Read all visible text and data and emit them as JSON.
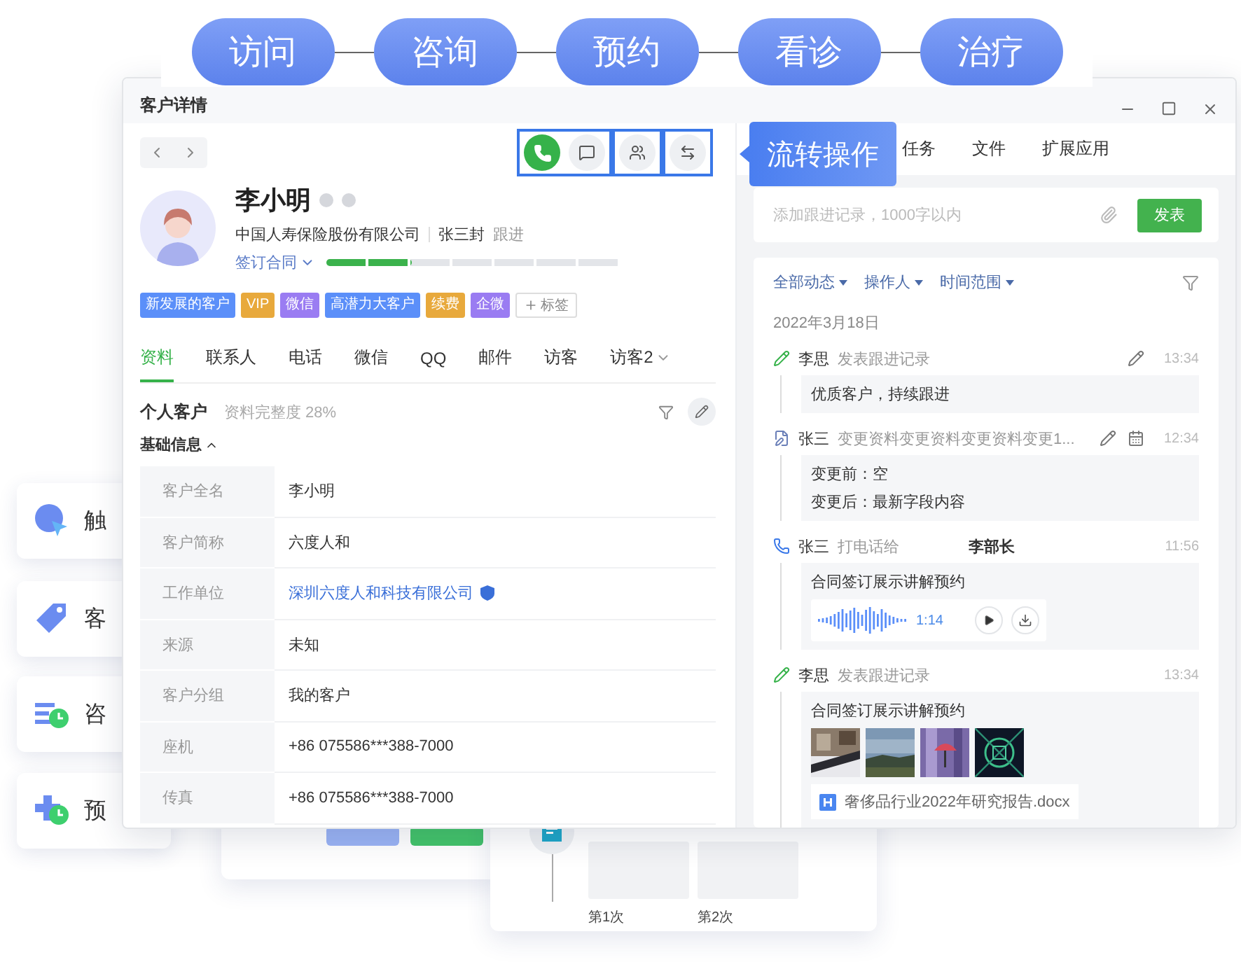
{
  "flow_steps": [
    {
      "label": "访问"
    },
    {
      "label": "咨询"
    },
    {
      "label": "预约"
    },
    {
      "label": "看诊"
    },
    {
      "label": "治疗"
    }
  ],
  "side_cards": [
    {
      "kind": "reach",
      "label": "触"
    },
    {
      "kind": "tag",
      "label": "客"
    },
    {
      "kind": "consult",
      "label": "咨"
    },
    {
      "kind": "booking",
      "label": "预"
    }
  ],
  "bottom_cards": {
    "visits": [
      {
        "label": "第1次"
      },
      {
        "label": "第2次"
      }
    ]
  },
  "window": {
    "title": "客户详情"
  },
  "action_groups": [
    [
      {
        "kind": "call"
      },
      {
        "kind": "message"
      }
    ],
    [
      {
        "kind": "contacts"
      }
    ],
    [
      {
        "kind": "transfer"
      }
    ]
  ],
  "callout": "流转操作",
  "customer": {
    "name": "李小明",
    "company": "中国人寿保险股份有限公司",
    "owner": "张三封",
    "owner_action": "跟进",
    "stage": "签订合同",
    "progress": {
      "level": 0.29
    }
  },
  "tags": [
    {
      "label": "新发展的客户",
      "color": "#5b8ff9"
    },
    {
      "label": "VIP",
      "color": "#e8a93c"
    },
    {
      "label": "微信",
      "color": "#9a7cf2"
    },
    {
      "label": "高潜力大客户",
      "color": "#5b8ff9"
    },
    {
      "label": "续费",
      "color": "#e8a93c"
    },
    {
      "label": "企微",
      "color": "#9a7cf2"
    }
  ],
  "add_tag": "标签",
  "tabs": [
    {
      "label": "资料",
      "selected": true,
      "dropdown": false
    },
    {
      "label": "联系人",
      "selected": false,
      "dropdown": false
    },
    {
      "label": "电话",
      "selected": false,
      "dropdown": false
    },
    {
      "label": "微信",
      "selected": false,
      "dropdown": false
    },
    {
      "label": "QQ",
      "selected": false,
      "dropdown": false
    },
    {
      "label": "邮件",
      "selected": false,
      "dropdown": false
    },
    {
      "label": "访客",
      "selected": false,
      "dropdown": false
    },
    {
      "label": "访客2",
      "selected": false,
      "dropdown": true
    }
  ],
  "section": {
    "title": "个人客户",
    "completeness": "资料完整度 28%",
    "group": "基础信息"
  },
  "fields": [
    {
      "label": "客户全名",
      "value": "李小明",
      "kind": "text"
    },
    {
      "label": "客户简称",
      "value": "六度人和",
      "kind": "text"
    },
    {
      "label": "工作单位",
      "value": "深圳六度人和科技有限公司",
      "kind": "link"
    },
    {
      "label": "来源",
      "value": "未知",
      "kind": "text"
    },
    {
      "label": "客户分组",
      "value": "我的客户",
      "kind": "text"
    },
    {
      "label": "座机",
      "value": "+86 075586***388-7000",
      "kind": "text"
    },
    {
      "label": "传真",
      "value": "+86 075586***388-7000",
      "kind": "text"
    }
  ],
  "right_tabs": [
    {
      "label": "任务"
    },
    {
      "label": "文件"
    },
    {
      "label": "扩展应用"
    }
  ],
  "composer": {
    "placeholder": "添加跟进记录，1000字以内",
    "submit": "发表"
  },
  "filters": [
    {
      "label": "全部动态"
    },
    {
      "label": "操作人"
    },
    {
      "label": "时间范围"
    }
  ],
  "feed": {
    "date": "2022年3月18日",
    "entries": [
      {
        "kind": "note",
        "user": "李思",
        "action": "发表跟进记录",
        "time": "13:34",
        "tools": [
          {
            "kind": "edit"
          }
        ],
        "lines": [
          "优质客户，持续跟进"
        ]
      },
      {
        "kind": "change",
        "user": "张三",
        "action": "变更资料变更资料变更资料变更1...",
        "time": "12:34",
        "tools": [
          {
            "kind": "edit"
          },
          {
            "kind": "calendar"
          }
        ],
        "lines": [
          "变更前：空",
          "变更后：最新字段内容"
        ]
      },
      {
        "kind": "call",
        "user": "张三",
        "action": "打电话给",
        "target": "李部长",
        "time": "11:56",
        "lines": [
          "合同签订展示讲解预约"
        ],
        "audio": "1:14"
      },
      {
        "kind": "note",
        "user": "李思",
        "action": "发表跟进记录",
        "time": "13:34",
        "lines": [
          "合同签订展示讲解预约"
        ],
        "pictures": [
          {
            "kind": "picture"
          },
          {
            "kind": "picture"
          },
          {
            "kind": "picture"
          },
          {
            "kind": "picture"
          }
        ],
        "file": "奢侈品行业2022年研究报告.docx"
      }
    ]
  }
}
